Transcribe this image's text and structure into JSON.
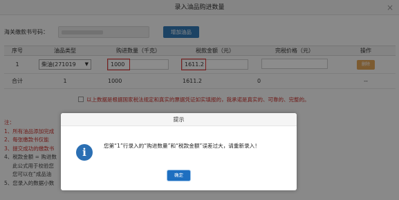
{
  "window": {
    "title": "录入油品购进数量",
    "close_label": "×"
  },
  "form": {
    "cert_label": "海关缴款书号码：",
    "add_button": "增加油品"
  },
  "table": {
    "headers": [
      "序号",
      "油品类型",
      "购进数量（千克）",
      "税款金额（元）",
      "完税价格（元）",
      "操作"
    ],
    "row": {
      "index": "1",
      "oil_type": "柴油(271019",
      "quantity": "1000",
      "tax": "1611.2",
      "price": "",
      "delete": "删除"
    },
    "summary": {
      "label": "合计",
      "count": "1",
      "quantity": "1000",
      "tax": "1611.2",
      "price": "0",
      "op": "--"
    }
  },
  "confirm_text": "以上数据是根据国家税法规定和真实的票据凭证如实填报的，我承诺是真实的、可靠的、完整的。",
  "notes": {
    "title": "注：",
    "n1": "1、所有油品添加完成",
    "n2": "2、每张缴款书仅能",
    "n3": "3、提交成功的缴款书",
    "n4a": "4、税款金额 = 购进数",
    "n4b": "此公式用于校验您",
    "n4c": "您可以在“成品油",
    "n5": "5、您录入的数据小数"
  },
  "dialog": {
    "title": "提示",
    "message": "您第“1”行录入的“购进数量”和“税款金额”误差过大，请重新录入！",
    "ok_button": "确定",
    "icon": "info-icon"
  }
}
